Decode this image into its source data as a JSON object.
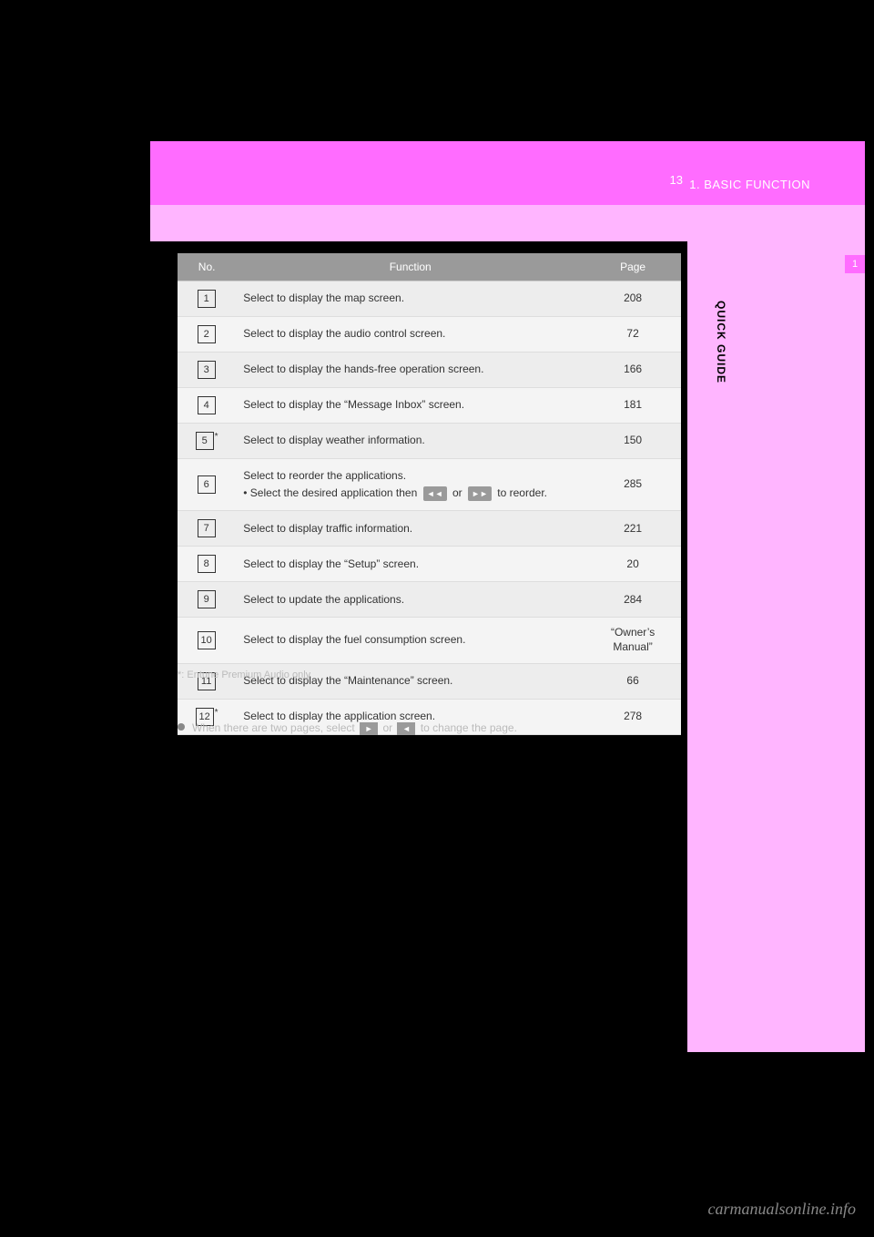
{
  "header": {
    "section": "1. BASIC FUNCTION",
    "page_number": "13"
  },
  "side": {
    "tab_number": "1",
    "label": "QUICK GUIDE"
  },
  "table": {
    "headers": {
      "no": "No.",
      "function": "Function",
      "page": "Page"
    },
    "rows": [
      {
        "no": "1",
        "star": "",
        "function": "Select to display the map screen.",
        "page": "208"
      },
      {
        "no": "2",
        "star": "",
        "function": "Select to display the audio control screen.",
        "page": "72"
      },
      {
        "no": "3",
        "star": "",
        "function": "Select to display the hands-free operation screen.",
        "page": "166"
      },
      {
        "no": "4",
        "star": "",
        "function": "Select to display the “Message Inbox” screen.",
        "page": "181"
      },
      {
        "no": "5",
        "star": "*",
        "function": "Select to display weather information.",
        "page": "150"
      },
      {
        "no": "6",
        "star": "",
        "function_line1": "Select to reorder the applications.",
        "function_line2_pre": "• Select the desired application then ",
        "function_line2_mid": " or ",
        "function_line2_post": " to reorder.",
        "page": "285"
      },
      {
        "no": "7",
        "star": "",
        "function": "Select to display traffic information.",
        "page": "221"
      },
      {
        "no": "8",
        "star": "",
        "function": "Select to display the “Setup” screen.",
        "page": "20"
      },
      {
        "no": "9",
        "star": "",
        "function": "Select to update the applications.",
        "page": "284"
      },
      {
        "no": "10",
        "star": "",
        "function": "Select to display the fuel consumption screen.",
        "page": "“Owner’s Manual”"
      },
      {
        "no": "11",
        "star": "",
        "function": "Select to display the “Maintenance” screen.",
        "page": "66"
      },
      {
        "no": "12",
        "star": "*",
        "function": "Select to display the application screen.",
        "page": "278"
      }
    ]
  },
  "footnote": "*: Entune Premium Audio only",
  "info_note": {
    "pre": "When there are two pages, select ",
    "mid": " or ",
    "post": " to change the page."
  },
  "icons": {
    "rewind": "◄◄",
    "forward": "►►",
    "next": "►",
    "prev": "◄"
  },
  "watermark": "carmanualsonline.info"
}
